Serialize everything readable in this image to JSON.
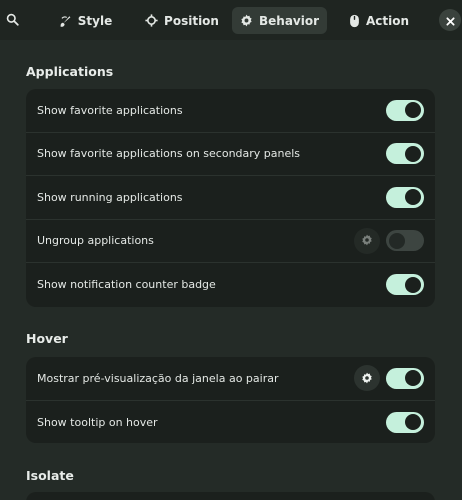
{
  "tabs": [
    {
      "label": "Style",
      "icon": "brush-icon"
    },
    {
      "label": "Position",
      "icon": "crosshair-icon"
    },
    {
      "label": "Behavior",
      "icon": "gear-icon"
    },
    {
      "label": "Action",
      "icon": "mouse-icon"
    }
  ],
  "active_tab": "Behavior",
  "sections": {
    "applications": {
      "title": "Applications",
      "rows": [
        {
          "label": "Show favorite applications",
          "enabled": true
        },
        {
          "label": "Show favorite applications on secondary panels",
          "enabled": true
        },
        {
          "label": "Show running applications",
          "enabled": true
        },
        {
          "label": "Ungroup applications",
          "enabled": false,
          "settings_icon": "gear-icon"
        },
        {
          "label": "Show notification counter badge",
          "enabled": true
        }
      ]
    },
    "hover": {
      "title": "Hover",
      "rows": [
        {
          "label": "Mostrar pré-visualização da janela ao pairar",
          "enabled": true,
          "settings_icon": "gear-icon"
        },
        {
          "label": "Show tooltip on hover",
          "enabled": true
        }
      ]
    },
    "isolate": {
      "title": "Isolate"
    }
  },
  "colors": {
    "background": "#242b27",
    "card": "#1b201d",
    "toggle_on": "#c5f0dc",
    "toggle_off": "#3d4541"
  }
}
